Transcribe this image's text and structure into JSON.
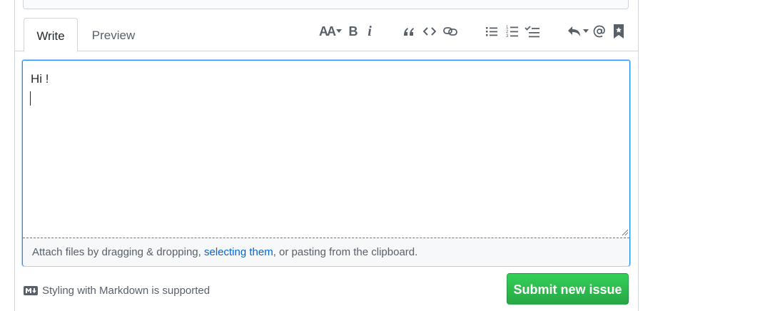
{
  "tabs": {
    "write_label": "Write",
    "preview_label": "Preview"
  },
  "toolbar": {
    "heading_label": "AA",
    "bold_label": "B",
    "italic_label": "i",
    "icons": [
      "header-icon",
      "bold-icon",
      "italic-icon",
      "quote-icon",
      "code-icon",
      "link-icon",
      "unordered-list-icon",
      "ordered-list-icon",
      "task-list-icon",
      "reply-icon",
      "mention-icon",
      "bookmark-icon"
    ]
  },
  "editor": {
    "value": "Hi !"
  },
  "dropzone": {
    "prefix": "Attach files by dragging & dropping, ",
    "link": "selecting them",
    "suffix": ", or pasting from the clipboard."
  },
  "footer": {
    "markdown_note": "Styling with Markdown is supported",
    "submit_label": "Submit new issue"
  },
  "colors": {
    "accent": "#2188ff",
    "link": "#0366d6",
    "submit": "#28a745"
  }
}
